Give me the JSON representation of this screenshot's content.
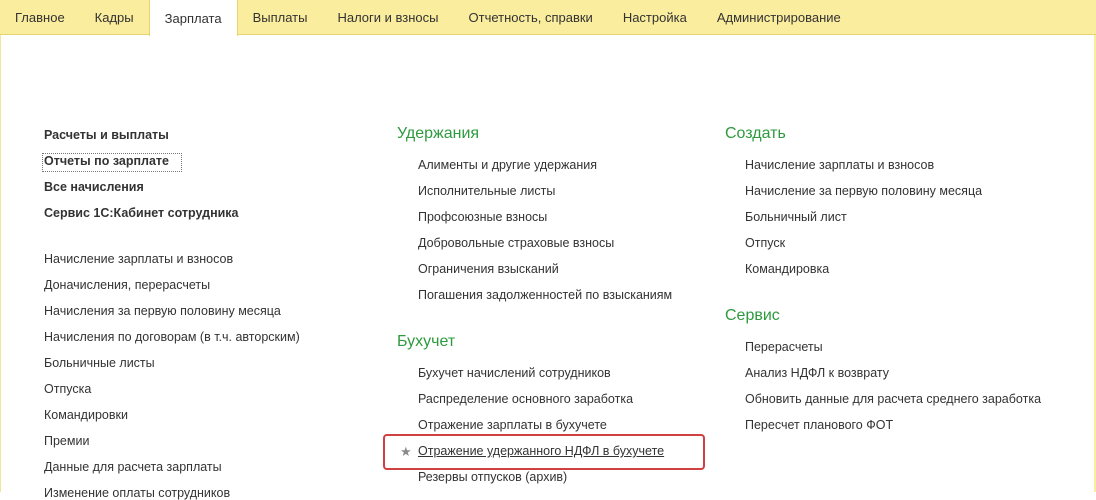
{
  "tabs": [
    {
      "label": "Главное"
    },
    {
      "label": "Кадры"
    },
    {
      "label": "Зарплата",
      "active": true
    },
    {
      "label": "Выплаты"
    },
    {
      "label": "Налоги и взносы"
    },
    {
      "label": "Отчетность, справки"
    },
    {
      "label": "Настройка"
    },
    {
      "label": "Администрирование"
    }
  ],
  "left": {
    "bold_items": [
      "Расчеты и выплаты",
      "Отчеты по зарплате",
      "Все начисления",
      "Сервис 1С:Кабинет сотрудника"
    ],
    "items": [
      "Начисление зарплаты и взносов",
      "Доначисления, перерасчеты",
      "Начисления за первую половину месяца",
      "Начисления по договорам (в т.ч. авторским)",
      "Больничные листы",
      "Отпуска",
      "Командировки",
      "Премии",
      "Данные для расчета зарплаты",
      "Изменение оплаты сотрудников"
    ]
  },
  "middle": {
    "uderzhaniya": {
      "title": "Удержания",
      "items": [
        "Алименты и другие удержания",
        "Исполнительные листы",
        "Профсоюзные взносы",
        "Добровольные страховые взносы",
        "Ограничения взысканий",
        "Погашения задолженностей по взысканиям"
      ]
    },
    "buhuchet": {
      "title": "Бухучет",
      "items": [
        "Бухучет начислений сотрудников",
        "Распределение основного заработка",
        "Отражение зарплаты в бухучете",
        "Отражение удержанного НДФЛ в бухучете",
        "Резервы отпусков (архив)"
      ]
    }
  },
  "right": {
    "sozdat": {
      "title": "Создать",
      "items": [
        "Начисление зарплаты и взносов",
        "Начисление за первую половину месяца",
        "Больничный лист",
        "Отпуск",
        "Командировка"
      ]
    },
    "servis": {
      "title": "Сервис",
      "items": [
        "Перерасчеты",
        "Анализ НДФЛ к возврату",
        "Обновить данные для расчета среднего заработка",
        "Пересчет планового ФОТ"
      ]
    }
  },
  "icons": {
    "favorite": "★"
  },
  "colors": {
    "topbar": "#fbed9e",
    "section_title": "#2d9a3e",
    "highlight": "#d04040"
  }
}
